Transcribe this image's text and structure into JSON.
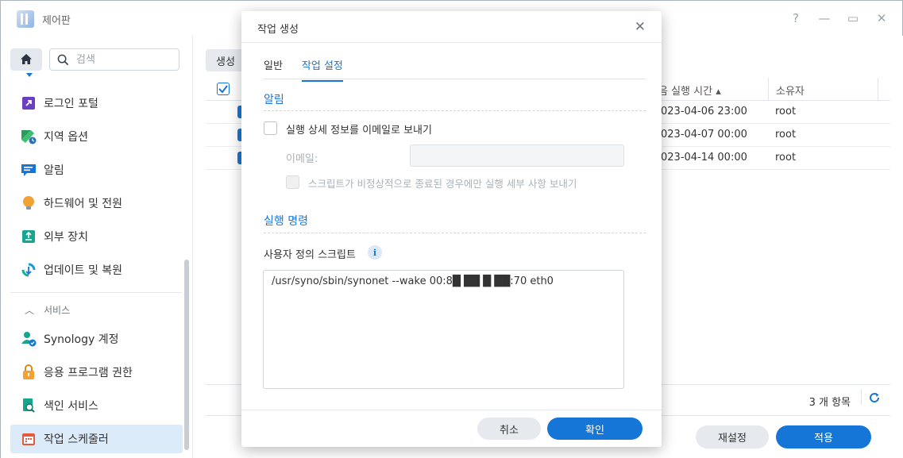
{
  "window": {
    "title": "제어판"
  },
  "sidebar": {
    "search_placeholder": "검색",
    "items": [
      {
        "label": "로그인 포털",
        "icon": "login-portal-icon"
      },
      {
        "label": "지역 옵션",
        "icon": "regional-options-icon"
      },
      {
        "label": "알림",
        "icon": "notification-icon"
      },
      {
        "label": "하드웨어 및 전원",
        "icon": "hardware-power-icon"
      },
      {
        "label": "외부 장치",
        "icon": "external-device-icon"
      },
      {
        "label": "업데이트 및 복원",
        "icon": "update-restore-icon"
      }
    ],
    "services_header": "서비스",
    "service_items": [
      {
        "label": "Synology 계정",
        "icon": "synology-account-icon"
      },
      {
        "label": "응용 프로그램 권한",
        "icon": "app-privileges-icon"
      },
      {
        "label": "색인 서비스",
        "icon": "indexing-service-icon"
      },
      {
        "label": "작업 스케줄러",
        "icon": "task-scheduler-icon"
      }
    ]
  },
  "content": {
    "create_button": "생성",
    "columns": {
      "next_run": "음 실행 시간 ▴",
      "owner": "소유자"
    },
    "rows": [
      {
        "next_run": "023-04-06 23:00",
        "owner": "root"
      },
      {
        "next_run": "023-04-07 00:00",
        "owner": "root"
      },
      {
        "next_run": "023-04-14 00:00",
        "owner": "root"
      }
    ],
    "item_count": "3 개 항목",
    "reset_button": "재설정",
    "apply_button": "적용"
  },
  "dialog": {
    "title": "작업 생성",
    "tabs": [
      "일반",
      "작업 설정"
    ],
    "active_tab": "작업 설정",
    "notification_section": "알림",
    "email_checkbox_label": "실행 상세 정보를 이메일로 보내기",
    "email_label": "이메일:",
    "email_value": "",
    "abnormal_checkbox_label": "스크립트가 비정상적으로 종료된 경우에만 실행 세부 사항 보내기",
    "run_command_section": "실행 명령",
    "user_script_label": "사용자 정의 스크립트",
    "script_value": "/usr/syno/sbin/synonet --wake 00:8█ ██ █ ██:70 eth0",
    "cancel_button": "취소",
    "ok_button": "확인"
  },
  "colors": {
    "accent": "#1676d8",
    "active_nav_bg": "#dcebfa"
  }
}
